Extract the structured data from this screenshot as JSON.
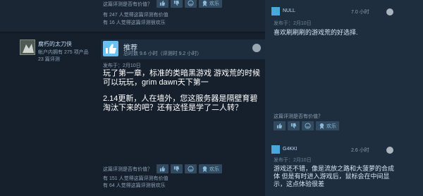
{
  "review_top": {
    "helpful_prompt": "这篇评测是否有价值？",
    "vote_buttons": [
      {
        "label": "",
        "icon": "thumbs-up-icon"
      },
      {
        "label": "",
        "icon": "thumbs-down-icon"
      },
      {
        "label": "",
        "icon": "smile-icon"
      },
      {
        "label": "欢乐",
        "icon": "award-icon"
      }
    ],
    "stat_helpful": "有 247 人觉得这篇评测有价值",
    "stat_funny": "有 16 人觉得这篇评测很欢乐"
  },
  "review": {
    "author": {
      "name": "腐朽的太刀侠",
      "games": "帐户内拥有 275 项产品",
      "reviews": "23 篇评测"
    },
    "verdict": "推荐",
    "hours": "总时数 9.6 小时（评测时 9.2 小时）",
    "posted": "发布于：2月10日",
    "paragraphs": [
      "玩了第一章，标准的类暗黑游戏 游戏荒的时候可以玩玩，grim dawn天下第一",
      "2.14更新，人在墙外，您这服务器是隔壁育碧淘汰下来的吧？还有这怪是学了二人转？"
    ]
  },
  "review_bottom": {
    "helpful_prompt": "这篇评测是否有价值？",
    "vote_buttons": [
      {
        "label": "",
        "icon": "thumbs-up-icon"
      },
      {
        "label": "",
        "icon": "thumbs-down-icon"
      },
      {
        "label": "",
        "icon": "smile-icon"
      },
      {
        "label": "欢乐",
        "icon": "award-icon"
      }
    ],
    "stat_helpful": "有 151 人觉得这篇评测有价值",
    "stat_funny": "有 64 人觉得这篇评测很欢乐"
  },
  "comments": [
    {
      "name": "NULL",
      "time": "7.0 小时",
      "posted": "发布于：2月10日",
      "text": "喜欢刷刷刷的游戏荒的好选择.",
      "helpful_prompt": "这篇评测是否有价值？",
      "vote_buttons": [
        {
          "label": "",
          "icon": "thumbs-up-icon"
        },
        {
          "label": "",
          "icon": "thumbs-down-icon"
        },
        {
          "label": "",
          "icon": "smile-icon"
        },
        {
          "label": "欢乐",
          "icon": "award-icon"
        }
      ]
    },
    {
      "name": "G4KKI",
      "time": "2.6 小时",
      "posted": "发布于：2月10日",
      "text": "游戏还不错，像是流放之路和大菠萝的合成体 但是有时进入游戏后，鼠标会在中间显示，这点体验很差"
    }
  ]
}
